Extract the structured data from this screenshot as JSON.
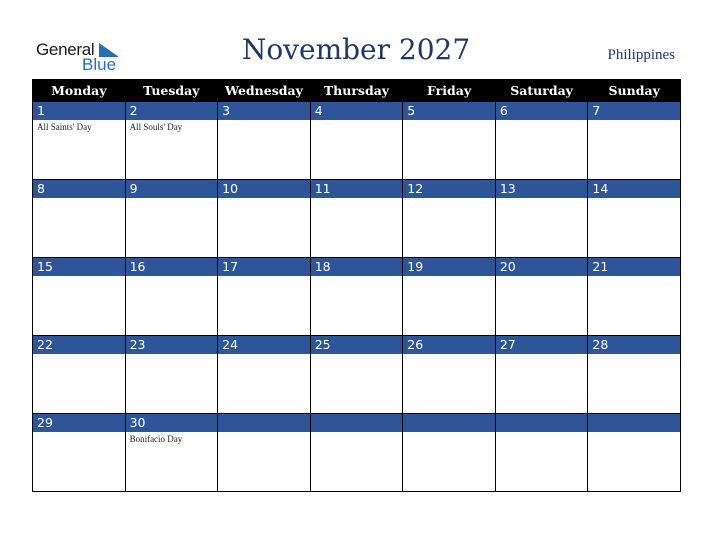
{
  "logo": {
    "line1": "General",
    "line2": "Blue",
    "accent_color": "#2a6db3"
  },
  "title": "November 2027",
  "country": "Philippines",
  "weekdays": [
    "Monday",
    "Tuesday",
    "Wednesday",
    "Thursday",
    "Friday",
    "Saturday",
    "Sunday"
  ],
  "colors": {
    "header_bg": "#000000",
    "band_bg": "#2d5597",
    "title": "#1f3864"
  },
  "weeks": [
    [
      {
        "day": "1",
        "holiday": "All Saints' Day"
      },
      {
        "day": "2",
        "holiday": "All Souls' Day"
      },
      {
        "day": "3",
        "holiday": ""
      },
      {
        "day": "4",
        "holiday": ""
      },
      {
        "day": "5",
        "holiday": ""
      },
      {
        "day": "6",
        "holiday": ""
      },
      {
        "day": "7",
        "holiday": ""
      }
    ],
    [
      {
        "day": "8",
        "holiday": ""
      },
      {
        "day": "9",
        "holiday": ""
      },
      {
        "day": "10",
        "holiday": ""
      },
      {
        "day": "11",
        "holiday": ""
      },
      {
        "day": "12",
        "holiday": ""
      },
      {
        "day": "13",
        "holiday": ""
      },
      {
        "day": "14",
        "holiday": ""
      }
    ],
    [
      {
        "day": "15",
        "holiday": ""
      },
      {
        "day": "16",
        "holiday": ""
      },
      {
        "day": "17",
        "holiday": ""
      },
      {
        "day": "18",
        "holiday": ""
      },
      {
        "day": "19",
        "holiday": ""
      },
      {
        "day": "20",
        "holiday": ""
      },
      {
        "day": "21",
        "holiday": ""
      }
    ],
    [
      {
        "day": "22",
        "holiday": ""
      },
      {
        "day": "23",
        "holiday": ""
      },
      {
        "day": "24",
        "holiday": ""
      },
      {
        "day": "25",
        "holiday": ""
      },
      {
        "day": "26",
        "holiday": ""
      },
      {
        "day": "27",
        "holiday": ""
      },
      {
        "day": "28",
        "holiday": ""
      }
    ],
    [
      {
        "day": "29",
        "holiday": ""
      },
      {
        "day": "30",
        "holiday": "Bonifacio Day"
      },
      {
        "day": "",
        "holiday": ""
      },
      {
        "day": "",
        "holiday": ""
      },
      {
        "day": "",
        "holiday": ""
      },
      {
        "day": "",
        "holiday": ""
      },
      {
        "day": "",
        "holiday": ""
      }
    ]
  ]
}
